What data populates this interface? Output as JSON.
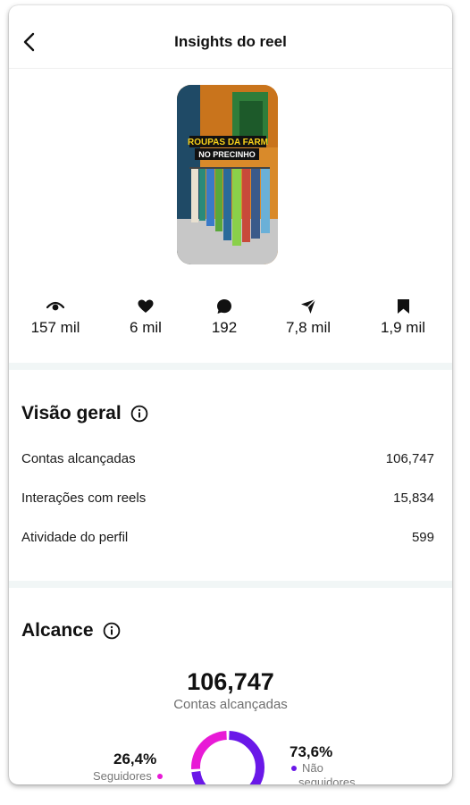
{
  "header": {
    "title": "Insights do reel"
  },
  "reel": {
    "overlay_line1": "ROUPAS DA FARM",
    "overlay_line2": "NO PRECINHO"
  },
  "metrics": [
    {
      "icon": "eye-icon",
      "value": "157 mil"
    },
    {
      "icon": "heart-icon",
      "value": "6 mil"
    },
    {
      "icon": "comment-icon",
      "value": "192"
    },
    {
      "icon": "send-icon",
      "value": "7,8 mil"
    },
    {
      "icon": "bookmark-icon",
      "value": "1,9 mil"
    }
  ],
  "overview": {
    "title": "Visão geral",
    "rows": [
      {
        "label": "Contas alcançadas",
        "value": "106,747"
      },
      {
        "label": "Interações com reels",
        "value": "15,834"
      },
      {
        "label": "Atividade do perfil",
        "value": "599"
      }
    ]
  },
  "reach": {
    "title": "Alcance",
    "total": "106,747",
    "total_label": "Contas alcançadas",
    "followers_pct": "26,4%",
    "followers_label": "Seguidores",
    "nonfollowers_pct": "73,6%",
    "nonfollowers_label_line1": "Não",
    "nonfollowers_label_line2": "seguidores",
    "followers_fraction": 0.264,
    "colors": {
      "followers": "#e81ad6",
      "nonfollowers": "#6a18e8"
    }
  }
}
